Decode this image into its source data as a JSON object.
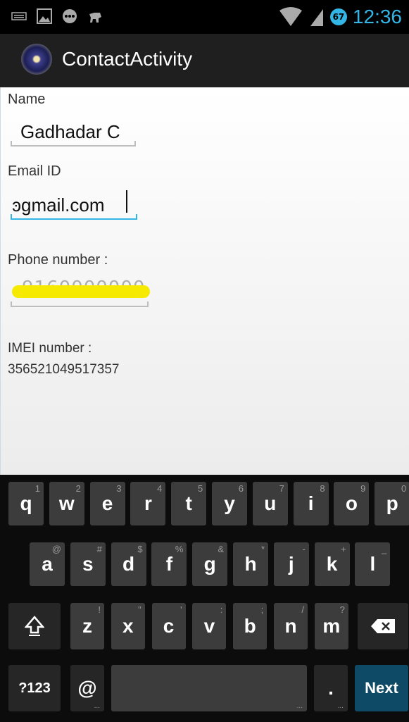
{
  "status_bar": {
    "time": "12:36",
    "battery_level": "67"
  },
  "action_bar": {
    "title": "ContactActivity"
  },
  "form": {
    "name_label": "Name",
    "name_value": "Gadhadar C",
    "email_label": "Email ID",
    "email_value": "ͽgmail.com",
    "phone_label": "Phone number :",
    "phone_value": "9160000000",
    "imei_label": "IMEI number :",
    "imei_value": "356521049517357"
  },
  "keyboard": {
    "row1": [
      {
        "label": "q",
        "hint": "1"
      },
      {
        "label": "w",
        "hint": "2"
      },
      {
        "label": "e",
        "hint": "3"
      },
      {
        "label": "r",
        "hint": "4"
      },
      {
        "label": "t",
        "hint": "5"
      },
      {
        "label": "y",
        "hint": "6"
      },
      {
        "label": "u",
        "hint": "7"
      },
      {
        "label": "i",
        "hint": "8"
      },
      {
        "label": "o",
        "hint": "9"
      },
      {
        "label": "p",
        "hint": "0"
      }
    ],
    "row2": [
      {
        "label": "a",
        "hint": "@"
      },
      {
        "label": "s",
        "hint": "#"
      },
      {
        "label": "d",
        "hint": "$"
      },
      {
        "label": "f",
        "hint": "%"
      },
      {
        "label": "g",
        "hint": "&"
      },
      {
        "label": "h",
        "hint": "*"
      },
      {
        "label": "j",
        "hint": "-"
      },
      {
        "label": "k",
        "hint": "+"
      },
      {
        "label": "l",
        "hint": "_"
      }
    ],
    "row3": [
      {
        "label": "z",
        "hint": "!"
      },
      {
        "label": "x",
        "hint": "\""
      },
      {
        "label": "c",
        "hint": "'"
      },
      {
        "label": "v",
        "hint": ":"
      },
      {
        "label": "b",
        "hint": ";"
      },
      {
        "label": "n",
        "hint": "/"
      },
      {
        "label": "m",
        "hint": "?"
      }
    ],
    "symbols_label": "?123",
    "at_label": "@",
    "period_label": ".",
    "next_label": "Next"
  },
  "colors": {
    "accent": "#33b5e5",
    "highlight": "#f5ea00",
    "next_key": "#0e4966"
  }
}
